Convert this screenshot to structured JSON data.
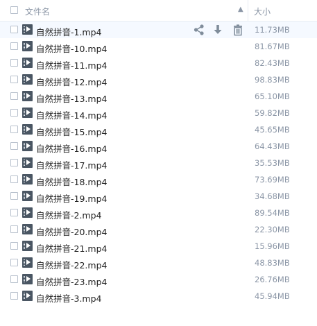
{
  "header": {
    "name_label": "文件名",
    "sort_glyph": "▲",
    "size_label": "大小"
  },
  "icons": {
    "checkbox": "checkbox-icon",
    "file": "video-file-icon",
    "share": "share-icon",
    "download": "download-icon",
    "delete": "trash-icon"
  },
  "colors": {
    "header_text": "#8b96a6",
    "hover_row": "#f5f9ff",
    "action_icon": "#7f8c9a"
  },
  "files": [
    {
      "name": "自然拼音-1.mp4",
      "size": "11.73MB"
    },
    {
      "name": "自然拼音-10.mp4",
      "size": "81.67MB"
    },
    {
      "name": "自然拼音-11.mp4",
      "size": "82.43MB"
    },
    {
      "name": "自然拼音-12.mp4",
      "size": "98.83MB"
    },
    {
      "name": "自然拼音-13.mp4",
      "size": "65.10MB"
    },
    {
      "name": "自然拼音-14.mp4",
      "size": "59.82MB"
    },
    {
      "name": "自然拼音-15.mp4",
      "size": "45.65MB"
    },
    {
      "name": "自然拼音-16.mp4",
      "size": "64.43MB"
    },
    {
      "name": "自然拼音-17.mp4",
      "size": "35.53MB"
    },
    {
      "name": "自然拼音-18.mp4",
      "size": "73.69MB"
    },
    {
      "name": "自然拼音-19.mp4",
      "size": "34.68MB"
    },
    {
      "name": "自然拼音-2.mp4",
      "size": "89.54MB"
    },
    {
      "name": "自然拼音-20.mp4",
      "size": "22.30MB"
    },
    {
      "name": "自然拼音-21.mp4",
      "size": "15.96MB"
    },
    {
      "name": "自然拼音-22.mp4",
      "size": "48.83MB"
    },
    {
      "name": "自然拼音-23.mp4",
      "size": "26.76MB"
    },
    {
      "name": "自然拼音-3.mp4",
      "size": "45.94MB"
    }
  ]
}
